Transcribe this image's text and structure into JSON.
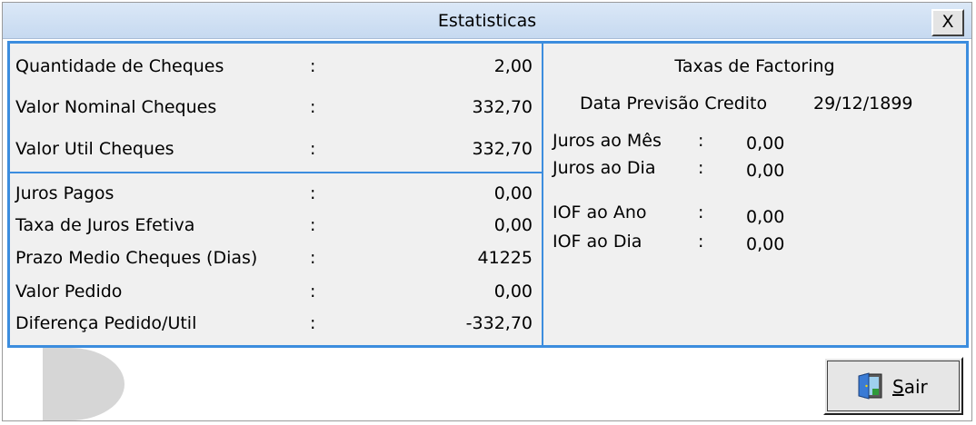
{
  "window": {
    "title": "Estatisticas",
    "close_label": "X"
  },
  "left": {
    "top_rows": [
      {
        "label": "Quantidade de Cheques",
        "value": "2,00"
      },
      {
        "label": "Valor Nominal Cheques",
        "value": "332,70"
      },
      {
        "label": "Valor Util Cheques",
        "value": "332,70"
      }
    ],
    "bottom_rows": [
      {
        "label": "Juros Pagos",
        "value": "0,00"
      },
      {
        "label": "Taxa de Juros Efetiva",
        "value": "0,00"
      },
      {
        "label": "Prazo Medio Cheques (Dias)",
        "value": "41225"
      },
      {
        "label": "Valor Pedido",
        "value": "0,00"
      },
      {
        "label": "Diferença Pedido/Util",
        "value": "-332,70"
      }
    ],
    "colon": ":"
  },
  "right": {
    "title": "Taxas de Factoring",
    "previsao_label": "Data Previsão Credito",
    "previsao_value": "29/12/1899",
    "rates": [
      {
        "label": "Juros ao Mês",
        "value": "0,00"
      },
      {
        "label": "Juros ao Dia",
        "value": "0,00"
      },
      {
        "label": "IOF ao Ano",
        "value": "0,00"
      },
      {
        "label": "IOF ao Dia",
        "value": "0,00"
      }
    ],
    "colon": ":"
  },
  "footer": {
    "exit_button": {
      "label_first": "S",
      "label_rest": "air",
      "icon": "exit-door-icon"
    }
  }
}
